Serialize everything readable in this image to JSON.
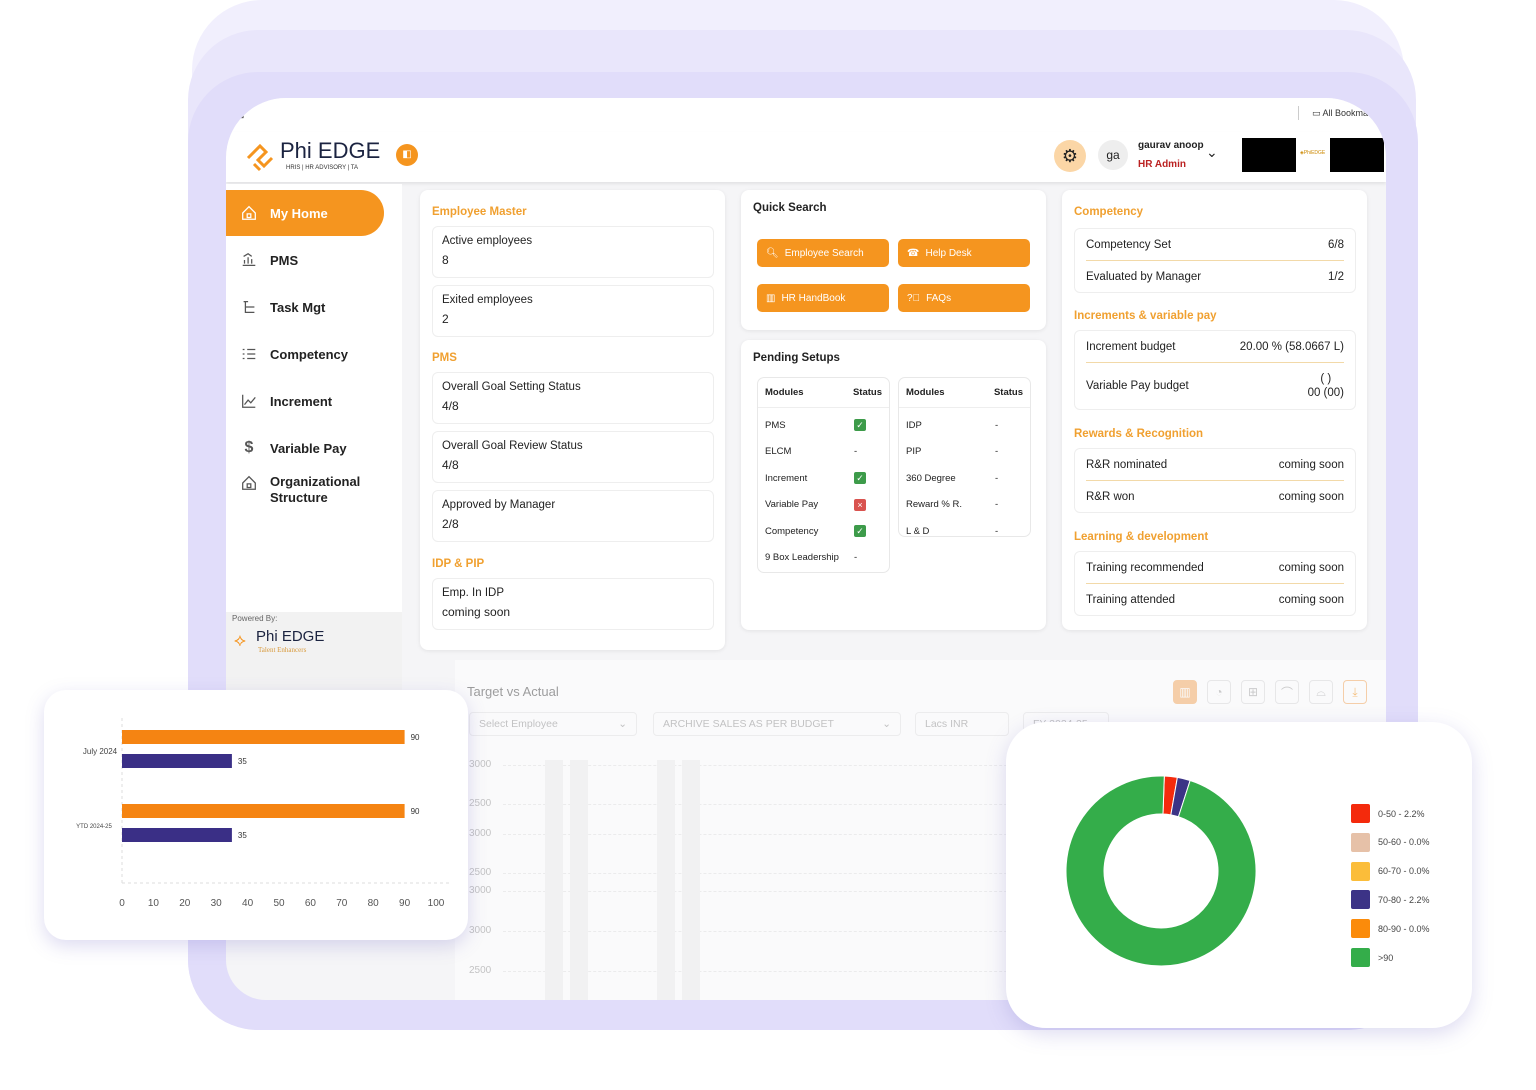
{
  "browser": {
    "bookmarks_label": "All Bookmarks"
  },
  "brand": {
    "name": "Phi EDGE",
    "tagline": "HRIS | HR ADVISORY | TA",
    "accent": "#f5951f"
  },
  "user": {
    "initials": "ga",
    "name": "gaurav anoop",
    "role": "HR Admin"
  },
  "sidebar": {
    "items": [
      {
        "label": "My Home",
        "icon": "home-icon",
        "active": true
      },
      {
        "label": "PMS",
        "icon": "pms-icon"
      },
      {
        "label": "Task Mgt",
        "icon": "task-icon"
      },
      {
        "label": "Competency",
        "icon": "list-icon"
      },
      {
        "label": "Increment",
        "icon": "chart-line-icon"
      },
      {
        "label": "Variable Pay",
        "icon": "dollar-icon"
      },
      {
        "label": "Organizational Structure",
        "icon": "org-icon"
      }
    ],
    "powered_by": "Powered By:",
    "powered_brand": "Phi EDGE",
    "powered_tagline": "Talent Enhancers"
  },
  "employee_master": {
    "title": "Employee Master",
    "items": [
      {
        "label": "Active employees",
        "value": "8"
      },
      {
        "label": "Exited employees",
        "value": "2"
      }
    ]
  },
  "pms": {
    "title": "PMS",
    "items": [
      {
        "label": "Overall Goal Setting Status",
        "value": "4/8"
      },
      {
        "label": "Overall Goal Review Status",
        "value": "4/8"
      },
      {
        "label": "Approved by Manager",
        "value": "2/8"
      }
    ]
  },
  "idp_pip": {
    "title": "IDP & PIP",
    "items": [
      {
        "label": "Emp. In IDP",
        "value": "coming soon"
      }
    ]
  },
  "quick_search": {
    "title": "Quick Search",
    "buttons": [
      "Employee Search",
      "Help Desk",
      "HR HandBook",
      "FAQs"
    ]
  },
  "pending": {
    "title": "Pending Setups",
    "col_modules": "Modules",
    "col_status": "Status",
    "left": [
      {
        "m": "PMS",
        "s": "done"
      },
      {
        "m": "ELCM",
        "s": "-"
      },
      {
        "m": "Increment",
        "s": "done"
      },
      {
        "m": "Variable Pay",
        "s": "failed"
      },
      {
        "m": "Competency",
        "s": "done"
      },
      {
        "m": "9 Box Leadership",
        "s": "-"
      }
    ],
    "right": [
      {
        "m": "IDP",
        "s": "-"
      },
      {
        "m": "PIP",
        "s": "-"
      },
      {
        "m": "360 Degree",
        "s": "-"
      },
      {
        "m": "Reward % R.",
        "s": "-"
      },
      {
        "m": "L & D",
        "s": "-"
      }
    ]
  },
  "competency": {
    "title": "Competency",
    "rows": [
      {
        "k": "Competency Set",
        "v": "6/8"
      },
      {
        "k": "Evaluated by Manager",
        "v": "1/2"
      }
    ]
  },
  "increments": {
    "title": "Increments & variable pay",
    "rows": [
      {
        "k": "Increment budget",
        "v": "20.00 % (58.0667 L)"
      },
      {
        "k": "Variable Pay budget",
        "v1": "( )",
        "v2": "00 (00)"
      }
    ]
  },
  "rewards": {
    "title": "Rewards & Recognition",
    "rows": [
      {
        "k": "R&R nominated",
        "v": "coming soon"
      },
      {
        "k": "R&R won",
        "v": "coming soon"
      }
    ]
  },
  "learning": {
    "title": "Learning & development",
    "rows": [
      {
        "k": "Training recommended",
        "v": "coming soon"
      },
      {
        "k": "Training attended",
        "v": "coming soon"
      }
    ]
  },
  "target": {
    "title": "Target vs Actual",
    "employee_placeholder": "Select Employee",
    "metric": "ARCHIVE SALES AS PER BUDGET",
    "unit": "Lacs INR",
    "fy": "FY 2024-25",
    "y_ticks": [
      "3000",
      "2500",
      "3000",
      "2500",
      "3000",
      "3000",
      "2500"
    ]
  },
  "chart_data": [
    {
      "type": "bar",
      "orientation": "horizontal",
      "categories": [
        "July 2024",
        "YTD 2024-25"
      ],
      "series": [
        {
          "values": [
            90,
            90
          ],
          "color": "#f58412"
        },
        {
          "values": [
            35,
            35
          ],
          "color": "#3a2f86"
        }
      ],
      "xlim": [
        0,
        100
      ],
      "x_ticks": [
        0,
        10,
        20,
        30,
        40,
        50,
        60,
        70,
        80,
        90,
        100
      ],
      "grid": true
    },
    {
      "type": "pie",
      "donut": true,
      "slices": [
        {
          "label": "0-50 - 2.2%",
          "value": 2.2,
          "color": "#f42a0c"
        },
        {
          "label": "50-60 - 0.0%",
          "value": 0,
          "color": "#e6c1a8"
        },
        {
          "label": "60-70 - 0.0%",
          "value": 0,
          "color": "#fbbd3a"
        },
        {
          "label": "70-80 - 2.2%",
          "value": 2.2,
          "color": "#3c3386"
        },
        {
          "label": "80-90 - 0.0%",
          "value": 0,
          "color": "#fb8b0a"
        },
        {
          "label": ">90",
          "value": 95.6,
          "color": "#34ad4a"
        }
      ],
      "legend": "right"
    }
  ]
}
